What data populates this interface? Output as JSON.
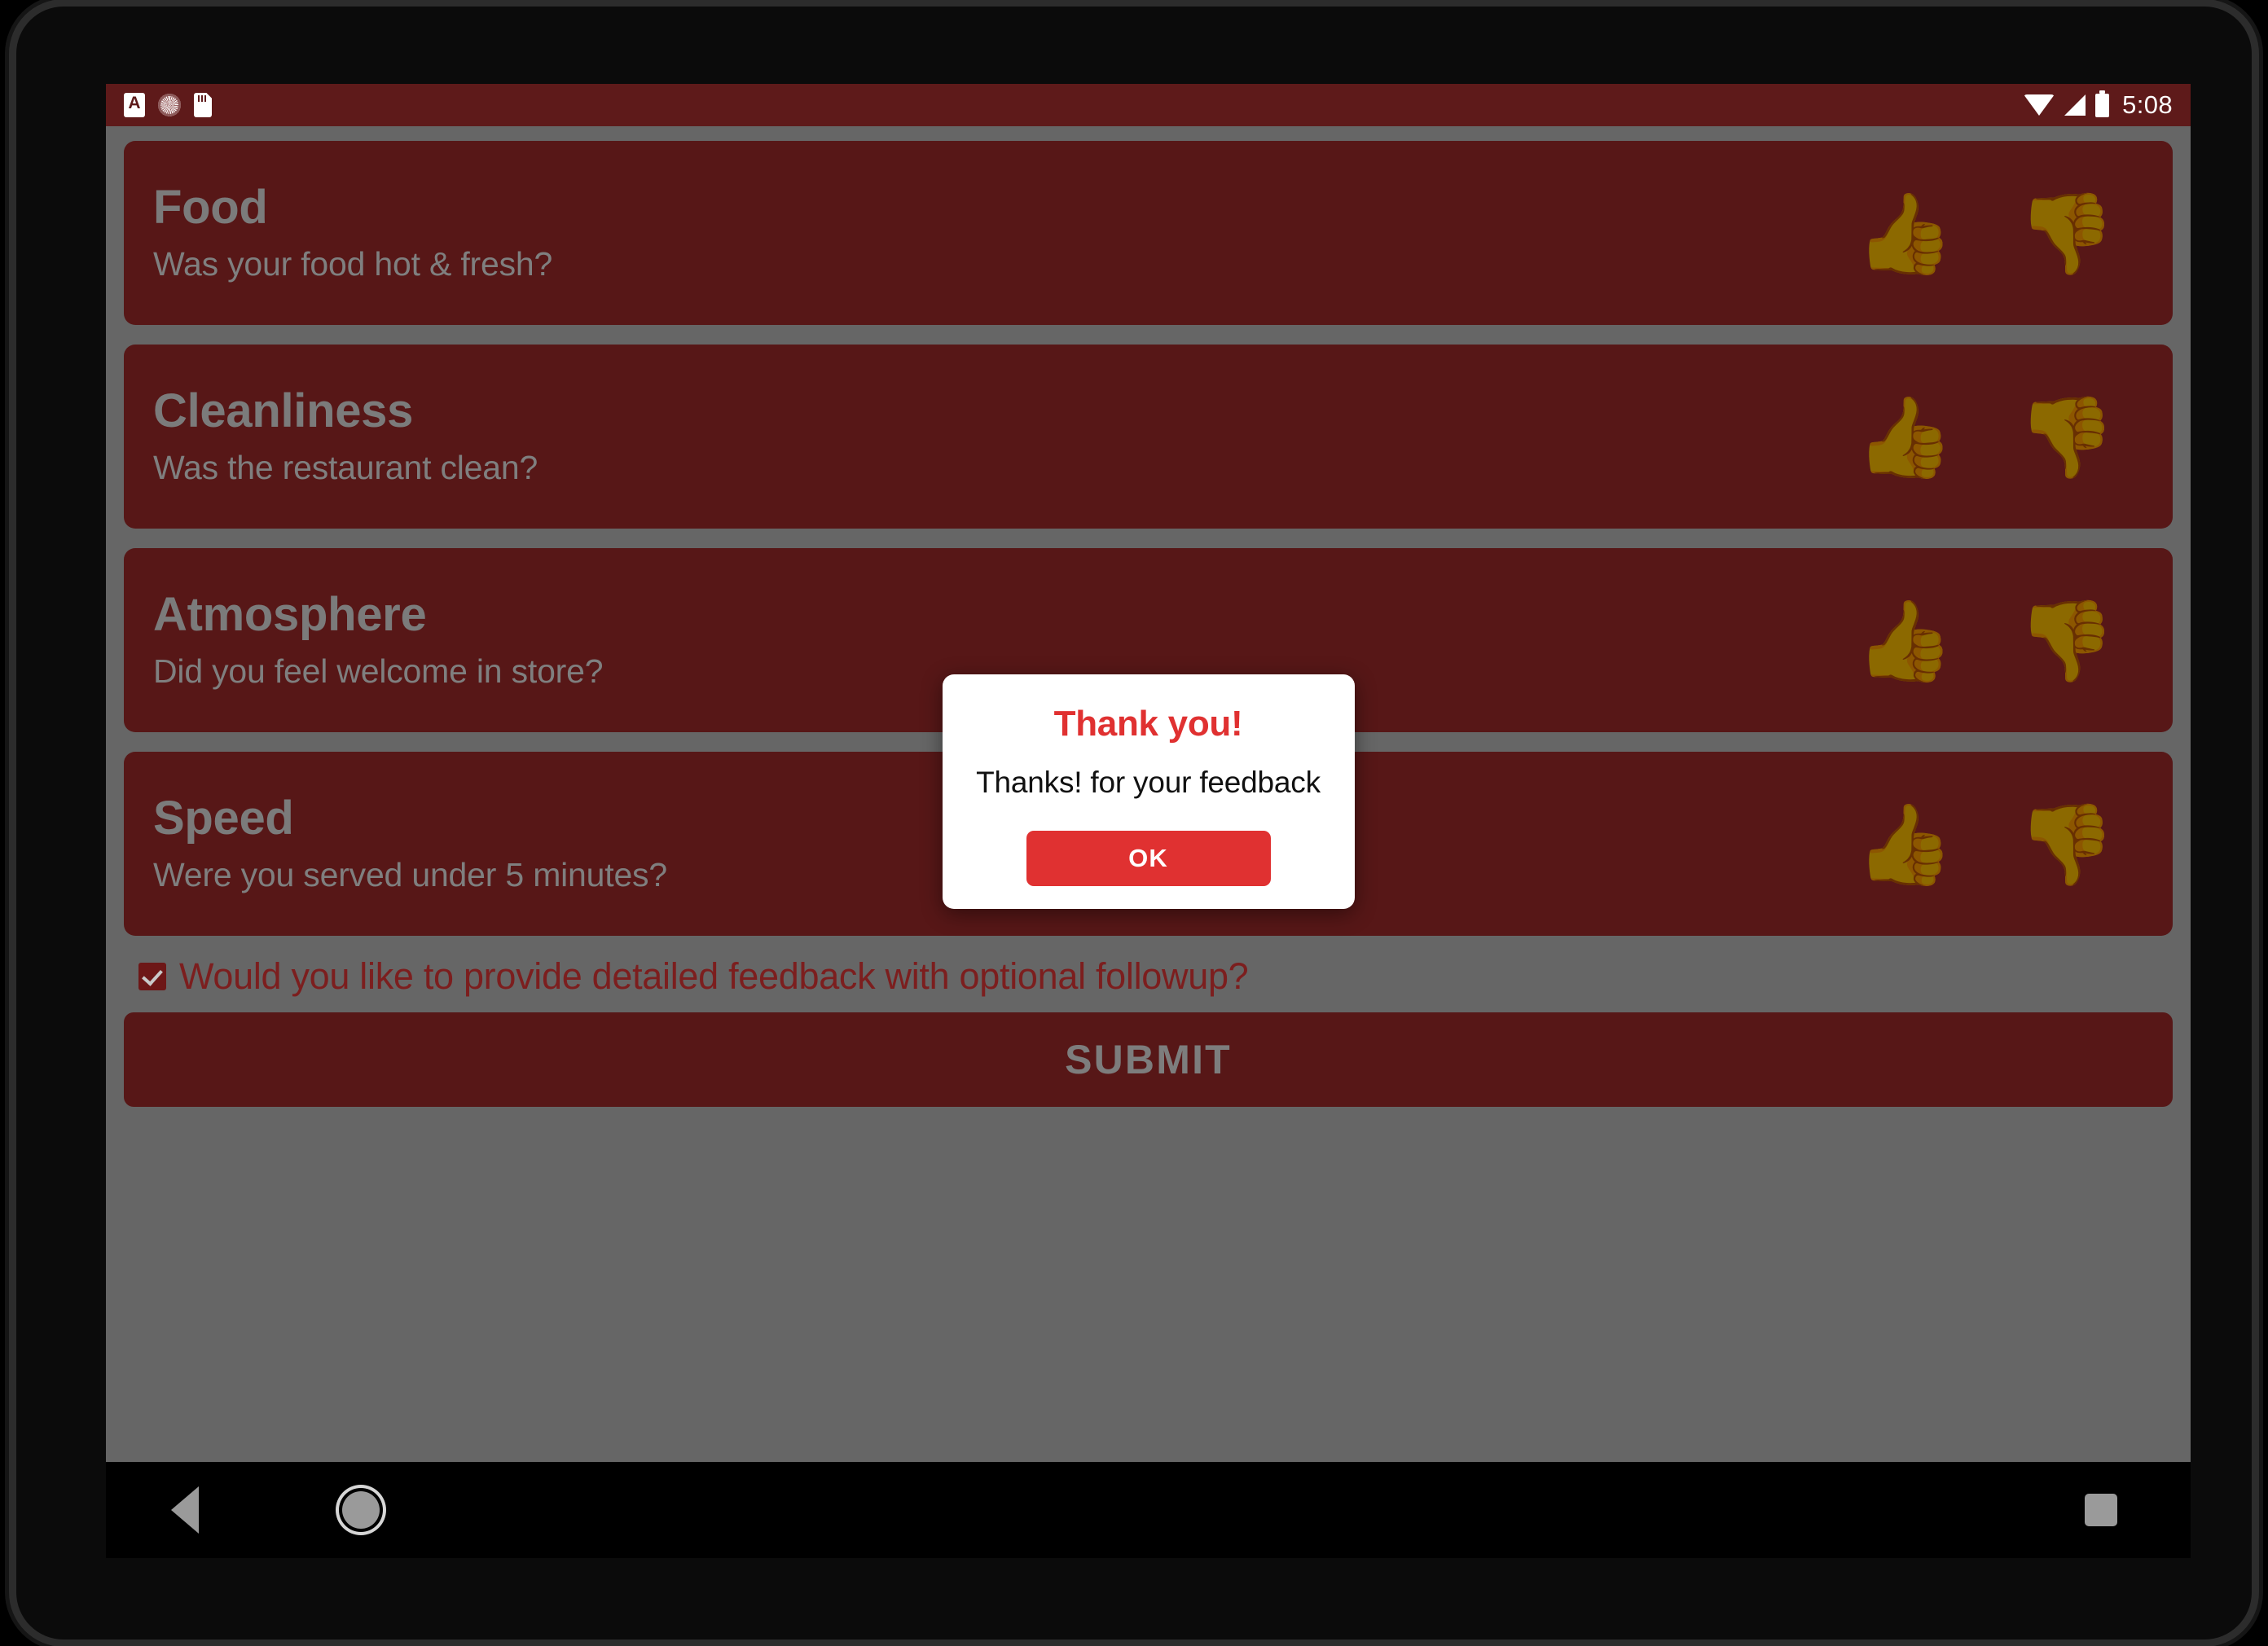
{
  "status_bar": {
    "left_icons": [
      "notification-a-icon",
      "sync-circle-icon",
      "sd-card-icon"
    ],
    "right_icons": [
      "wifi-icon",
      "cellular-signal-icon",
      "battery-icon"
    ],
    "time": "5:08"
  },
  "colors": {
    "card_background": "#571717",
    "screen_background": "#666666",
    "status_bar_background": "#5e1a1a",
    "accent_red": "#e03131",
    "card_text": "#7b7b7b",
    "checkbox_label": "#7c1e1e"
  },
  "questions": [
    {
      "title": "Food",
      "subtitle": "Was your food hot & fresh?",
      "thumbs_up": "👍",
      "thumbs_down": "👎"
    },
    {
      "title": "Cleanliness",
      "subtitle": "Was the restaurant clean?",
      "thumbs_up": "👍",
      "thumbs_down": "👎"
    },
    {
      "title": "Atmosphere",
      "subtitle": "Did you feel welcome in store?",
      "thumbs_up": "👍",
      "thumbs_down": "👎"
    },
    {
      "title": "Speed",
      "subtitle": "Were you served under 5 minutes?",
      "thumbs_up": "👍",
      "thumbs_down": "👎"
    }
  ],
  "followup": {
    "label": "Would you like to provide detailed feedback with optional followup?",
    "checked": true
  },
  "submit": {
    "label": "SUBMIT"
  },
  "dialog": {
    "title": "Thank you!",
    "message": "Thanks! for your feedback",
    "ok_label": "OK"
  },
  "nav_bar": {
    "back": "back-icon",
    "home": "home-icon",
    "recents": "recents-icon"
  }
}
